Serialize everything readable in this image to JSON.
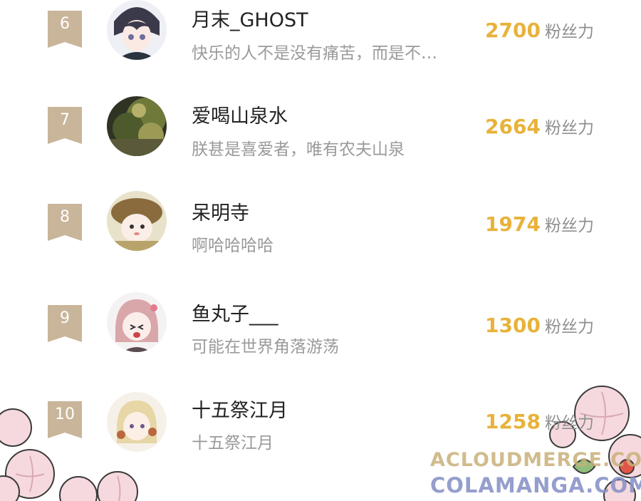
{
  "colors": {
    "fans_value": "#e8b23a",
    "rank_tag": "#c9b59a",
    "name": "#222222",
    "bio": "#9a9a9a"
  },
  "ranking": [
    {
      "rank": "6",
      "name": "月末_GHOST",
      "bio": "快乐的人不是没有痛苦，而是不…",
      "fans": "2700",
      "fans_label": "粉丝力",
      "avatar": "anime-boy-avatar"
    },
    {
      "rank": "7",
      "name": "爱喝山泉水",
      "bio": "朕甚是喜爱者，唯有农夫山泉",
      "fans": "2664",
      "fans_label": "粉丝力",
      "avatar": "forest-photo-avatar"
    },
    {
      "rank": "8",
      "name": "呆明寺",
      "bio": "啊哈哈哈哈",
      "fans": "1974",
      "fans_label": "粉丝力",
      "avatar": "chibi-mushroom-avatar"
    },
    {
      "rank": "9",
      "name": "鱼丸子___",
      "bio": "可能在世界角落游荡",
      "fans": "1300",
      "fans_label": "粉丝力",
      "avatar": "pink-hair-girl-avatar"
    },
    {
      "rank": "10",
      "name": "十五祭江月",
      "bio": "十五祭江月",
      "fans": "1258",
      "fans_label": "粉丝力",
      "avatar": "blonde-girl-avatar"
    }
  ],
  "watermark": {
    "line1": "ACLOUDMERGE.COM",
    "line2": "COLAMANGA.COM"
  }
}
